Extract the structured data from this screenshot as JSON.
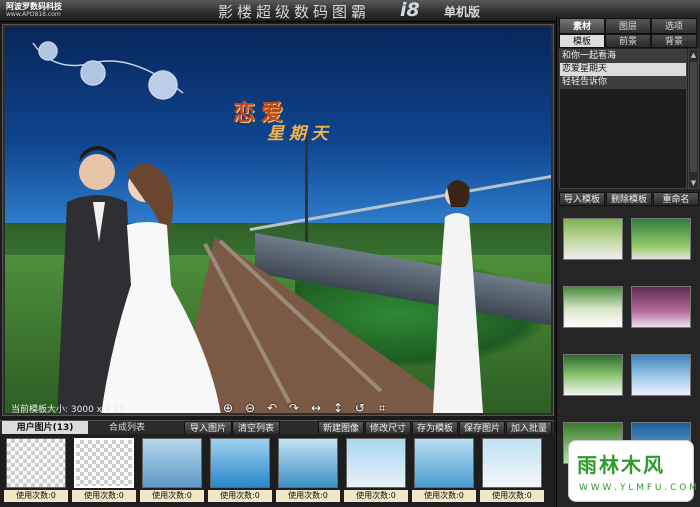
{
  "titlebar": {
    "brand_name": "阿波罗数码科技",
    "brand_url": "www.APO818.com",
    "title": "影楼超级数码图霸",
    "version": "i8",
    "edition": "单机版"
  },
  "canvas": {
    "photo_title_line1": "恋爱",
    "photo_title_line2": "星期天",
    "size_readout": "当前模板大小: 3000 x 2 25",
    "tools": [
      "zoom-in-icon",
      "zoom-out-icon",
      "rotate-left-icon",
      "rotate-right-icon",
      "flip-horizontal-icon",
      "flip-vertical-icon",
      "undo-icon",
      "crop-icon"
    ]
  },
  "right_panel": {
    "tabs": [
      "素材",
      "图层",
      "选项"
    ],
    "subtabs": [
      "模板",
      "前景",
      "背景"
    ],
    "templates": [
      "和你一起看海",
      "恋爱星期天",
      "轻轻告诉你"
    ],
    "buttons": [
      "导入模板",
      "删除模板",
      "重命名"
    ]
  },
  "bottom": {
    "tab_user": "用户图片(13)",
    "tab_comp": "合成列表",
    "buttons": [
      "导入图片",
      "清空列表",
      "新建图像",
      "修改尺寸",
      "存为模板",
      "保存图片",
      "加入批量"
    ],
    "usage_caption": "使用次数:0",
    "item_count": 8
  },
  "watermark": {
    "text": "雨林木风",
    "url": "W W W . Y L M F U . C O M"
  },
  "colors": {
    "accent": "#2f9b2a",
    "panel": "#252525"
  }
}
